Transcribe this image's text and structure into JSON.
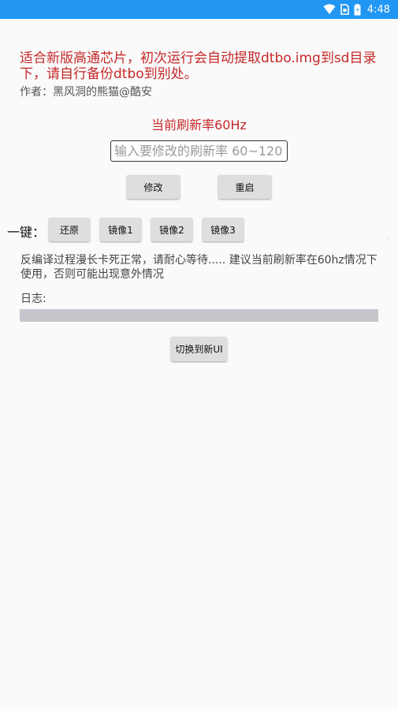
{
  "status_bar": {
    "time": "4:48",
    "icons": [
      "wifi-icon",
      "sim-card-icon",
      "battery-icon"
    ],
    "background": "#2196f3"
  },
  "header": {
    "notice": "适合新版高通芯片，初次运行会自动提取dtbo.img到sd目录下，请自行备份dtbo到别处。",
    "author": "作者：黑风洞的熊猫@酷安"
  },
  "refresh": {
    "current_label": "当前刷新率60Hz",
    "input_placeholder": "输入要修改的刷新率 60~120",
    "input_value": ""
  },
  "actions": {
    "modify_label": "修改",
    "reboot_label": "重启"
  },
  "one_key": {
    "label": "一键：",
    "buttons": [
      "还原",
      "镜像1",
      "镜像2",
      "镜像3"
    ]
  },
  "info": {
    "text": "反编译过程漫长卡死正常，请耐心等待..... 建议当前刷新率在60hz情况下使用，否则可能出现意外情况",
    "log_label": "日志:"
  },
  "switch_ui_label": "切换到新UI",
  "colors": {
    "accent_red": "#c62828",
    "button_grey": "#dedede",
    "log_bar": "#c6c6cc"
  }
}
